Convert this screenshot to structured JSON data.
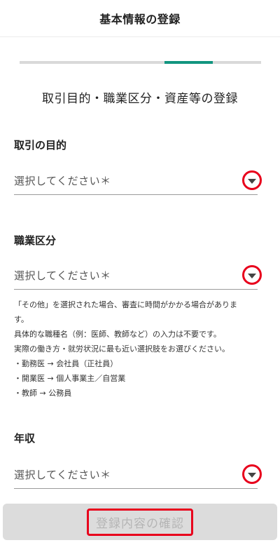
{
  "header": {
    "title": "基本情報の登録"
  },
  "progress": {
    "total_steps": 5,
    "current_step": 4
  },
  "step_title": "取引目的・職業区分・資産等の登録",
  "fields": {
    "purpose": {
      "label": "取引の目的",
      "placeholder": "選択してください＊"
    },
    "occupation": {
      "label": "職業区分",
      "placeholder": "選択してください＊"
    },
    "income": {
      "label": "年収",
      "placeholder": "選択してください＊"
    }
  },
  "occupation_note": {
    "line1": "「その他」を選択された場合、審査に時間がかかる場合がありま",
    "line2": "す。",
    "line3": "具体的な職種名（例：医師、教師など）の入力は不要です。",
    "line4": "実際の働き方・就労状況に最も近い選択肢をお選びください。",
    "example1": "・勤務医 → 会社員（正社員）",
    "example2": "・開業医 → 個人事業主／自営業",
    "example3": "・教師 → 公務員"
  },
  "footer": {
    "confirm_label": "登録内容の確認"
  },
  "colors": {
    "accent": "#12957f",
    "highlight": "#e8001c",
    "disabled_bg": "#dcdcdc"
  },
  "icons": {
    "dropdown": "chevron-down-icon"
  }
}
